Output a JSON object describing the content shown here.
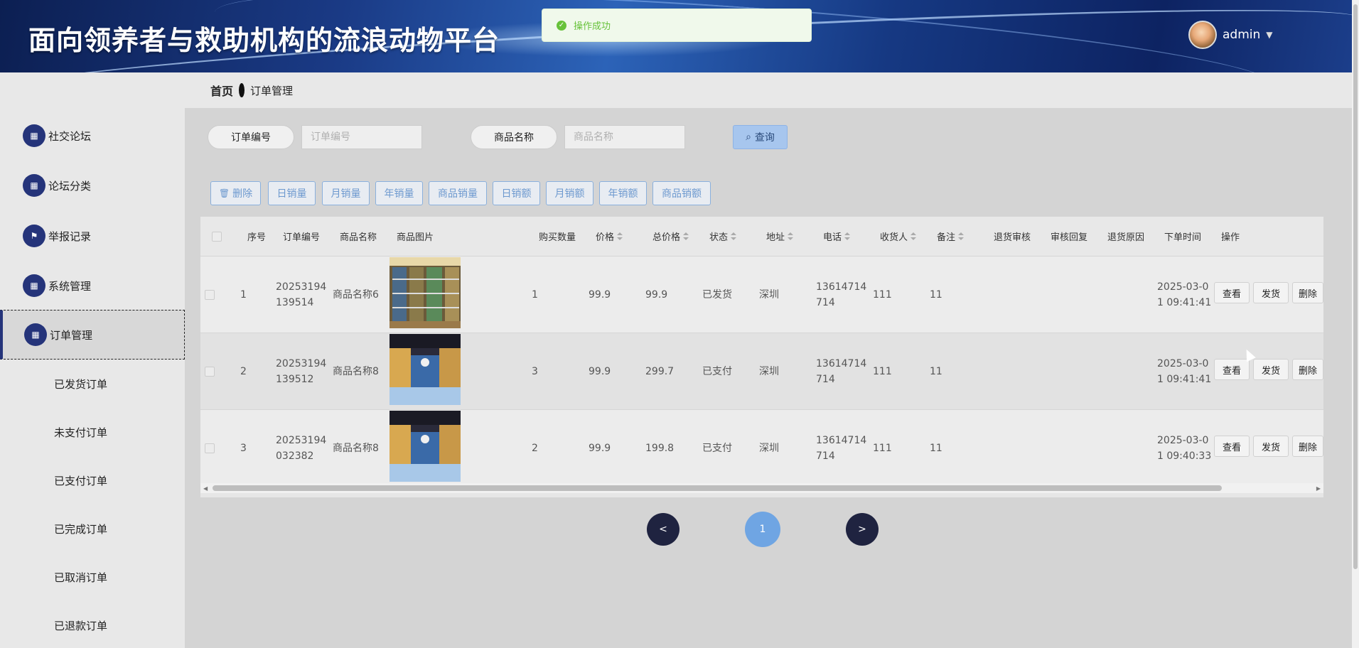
{
  "header": {
    "title": "面向领养者与救助机构的流浪动物平台",
    "user": "admin"
  },
  "toast": {
    "message": "操作成功"
  },
  "sidebar": {
    "items": [
      {
        "label": "社交论坛",
        "icon": "grid-icon"
      },
      {
        "label": "论坛分类",
        "icon": "grid-icon"
      },
      {
        "label": "举报记录",
        "icon": "flag-icon"
      },
      {
        "label": "系统管理",
        "icon": "grid-icon"
      },
      {
        "label": "订单管理",
        "icon": "grid-icon"
      }
    ],
    "sub_items": [
      "已发货订单",
      "未支付订单",
      "已支付订单",
      "已完成订单",
      "已取消订单",
      "已退款订单"
    ]
  },
  "breadcrumb": {
    "home": "首页",
    "current": "订单管理"
  },
  "search": {
    "order_no_label": "订单编号",
    "order_no_placeholder": "订单编号",
    "product_label": "商品名称",
    "product_placeholder": "商品名称",
    "query_label": "查询"
  },
  "actions": [
    "删除",
    "日销量",
    "月销量",
    "年销量",
    "商品销量",
    "日销额",
    "月销额",
    "年销额",
    "商品销额"
  ],
  "table": {
    "headers": [
      "序号",
      "订单编号",
      "商品名称",
      "商品图片",
      "购买数量",
      "价格",
      "总价格",
      "状态",
      "地址",
      "电话",
      "收货人",
      "备注",
      "退货审核",
      "审核回复",
      "退货原因",
      "下单时间",
      "操作"
    ],
    "rows": [
      {
        "index": "1",
        "order_no": "20253194139514",
        "product": "商品名称6",
        "qty": "1",
        "price": "99.9",
        "total": "99.9",
        "status": "已发货",
        "address": "深圳",
        "phone": "13614714714",
        "receiver": "111",
        "remark": "11",
        "time": "2025-03-01 09:41:41"
      },
      {
        "index": "2",
        "order_no": "20253194139512",
        "product": "商品名称8",
        "qty": "3",
        "price": "99.9",
        "total": "299.7",
        "status": "已支付",
        "address": "深圳",
        "phone": "13614714714",
        "receiver": "111",
        "remark": "11",
        "time": "2025-03-01 09:41:41"
      },
      {
        "index": "3",
        "order_no": "20253194032382",
        "product": "商品名称8",
        "qty": "2",
        "price": "99.9",
        "total": "199.8",
        "status": "已支付",
        "address": "深圳",
        "phone": "13614714714",
        "receiver": "111",
        "remark": "11",
        "time": "2025-03-01 09:40:33"
      }
    ],
    "row_actions": [
      "查看",
      "发货",
      "删除"
    ]
  },
  "pagination": {
    "prev": "<",
    "current": "1",
    "next": ">"
  },
  "colors": {
    "accent": "#25347a",
    "primary_light": "#6fa5e3",
    "success": "#67c23a"
  }
}
